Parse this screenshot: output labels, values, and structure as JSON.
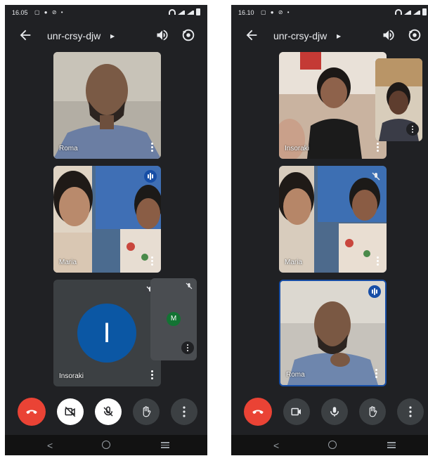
{
  "left": {
    "status": {
      "time": "16.05",
      "icons_left": "▢ ● ⊘ •"
    },
    "meeting_code": "unr-crsy-djw",
    "tiles": [
      {
        "name": "Roma"
      },
      {
        "name": "Maria"
      },
      {
        "name": "Insoraki",
        "initial": "I"
      }
    ],
    "self_view": {
      "initial": "M"
    }
  },
  "right": {
    "status": {
      "time": "16.10",
      "icons_left": "▢ ● ⊘ •"
    },
    "meeting_code": "unr-crsy-djw",
    "tiles": [
      {
        "name": "Insoraki"
      },
      {
        "name": "Maria"
      },
      {
        "name": "Roma"
      }
    ]
  },
  "colors": {
    "end_call": "#ea4335",
    "background": "#202124",
    "accent_blue": "#174ea6"
  }
}
